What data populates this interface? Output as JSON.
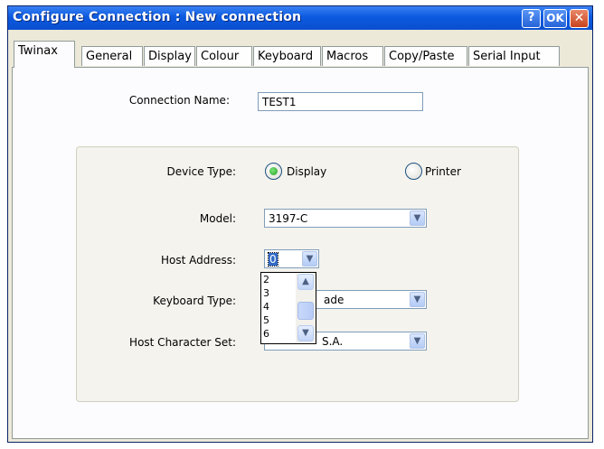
{
  "window": {
    "title": "Configure Connection : New connection",
    "help_label": "?",
    "ok_label": "OK",
    "close_label": "✕"
  },
  "tabs": [
    {
      "label": "Twinax",
      "active": true
    },
    {
      "label": "General"
    },
    {
      "label": "Display"
    },
    {
      "label": "Colour"
    },
    {
      "label": "Keyboard"
    },
    {
      "label": "Macros"
    },
    {
      "label": "Copy/Paste"
    },
    {
      "label": "Serial Input"
    }
  ],
  "form": {
    "connection_name_label": "Connection Name:",
    "connection_name_value": "TEST1",
    "device_type_label": "Device Type:",
    "device_type_options": [
      "Display",
      "Printer"
    ],
    "device_type_selected": "Display",
    "model_label": "Model:",
    "model_value": "3197-C",
    "host_address_label": "Host Address:",
    "host_address_value": "0",
    "host_address_options": [
      "2",
      "3",
      "4",
      "5",
      "6"
    ],
    "keyboard_type_label": "Keyboard Type:",
    "keyboard_type_value_visible": "ade",
    "host_charset_label": "Host Character Set:",
    "host_charset_value_visible": "S.A."
  },
  "icons": {
    "combo_arrow": "chevron-down-icon",
    "scroll_up": "chevron-up-icon",
    "scroll_down": "chevron-down-icon"
  },
  "colors": {
    "titlebar": "#0c5ae0",
    "window_bg": "#ece9d8",
    "radio_selected": "#21a121"
  }
}
